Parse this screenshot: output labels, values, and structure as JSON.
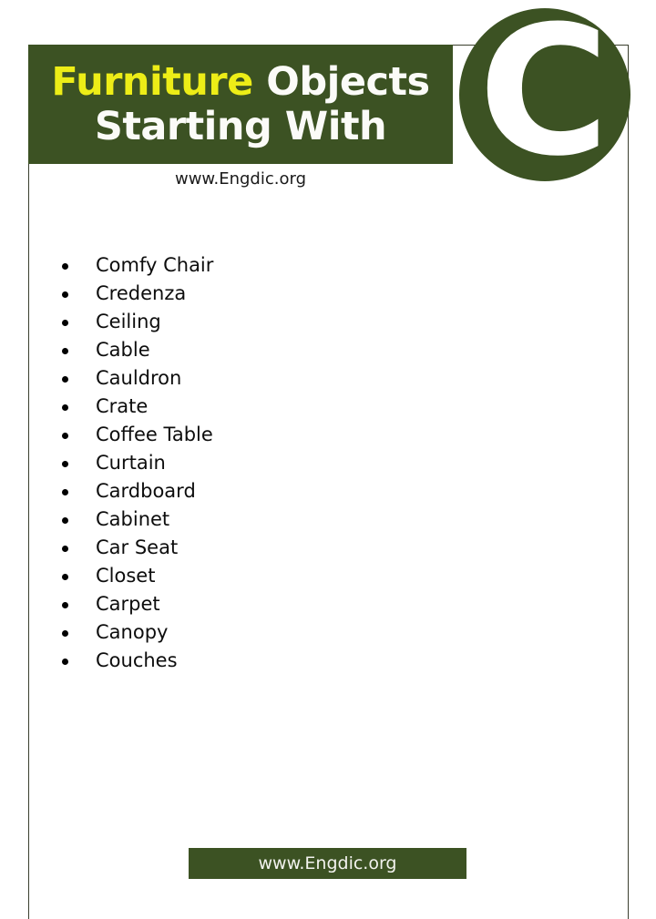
{
  "page": {
    "background_color": "#ffffff",
    "border_color": "#3a3f2e"
  },
  "header": {
    "background_color": "#3c5223",
    "accent_color": "#eded17",
    "plain_color": "#fbfbf8",
    "title_line_1_accent": "Furniture",
    "title_line_1_plain": " Objects",
    "title_line_2": "Starting With"
  },
  "letter_badge": {
    "letter": "C",
    "background_color": "#3c5223",
    "text_color": "#ffffff",
    "icon_name": "letter-c-circle-badge"
  },
  "site_url": "www.Engdic.org",
  "list": {
    "bullet_icon": "bullet-dot-icon",
    "items": [
      "Comfy Chair",
      "Credenza",
      "Ceiling",
      "Cable",
      "Cauldron",
      "Crate",
      "Coffee Table",
      "Curtain",
      "Cardboard",
      "Cabinet",
      "Car Seat",
      "Closet",
      "Carpet",
      "Canopy",
      "Couches"
    ]
  },
  "footer": {
    "text": "www.Engdic.org",
    "background_color": "#3c5223",
    "text_color": "#f2f2ee"
  }
}
